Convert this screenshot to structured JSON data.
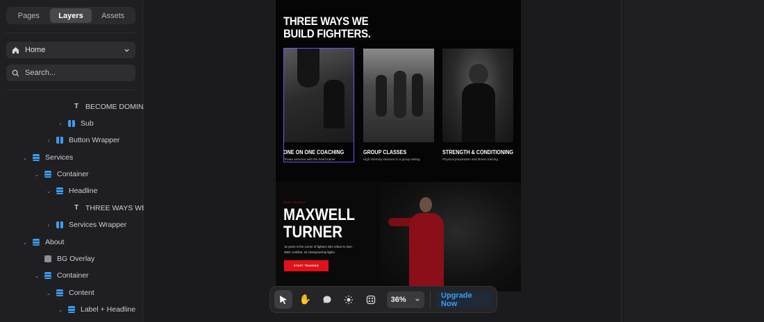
{
  "sidebar": {
    "tabs": [
      {
        "label": "Pages"
      },
      {
        "label": "Layers"
      },
      {
        "label": "Assets"
      }
    ],
    "page_select": {
      "value": "Home"
    },
    "search": {
      "placeholder": "Search..."
    },
    "layers": [
      {
        "label": "BECOME DOMINA",
        "icon": "text-icon",
        "depth": 4,
        "expandable": false
      },
      {
        "label": "Sub",
        "icon": "columns-icon",
        "depth": 3,
        "expandable": true
      },
      {
        "label": "Button Wrapper",
        "icon": "columns-icon",
        "depth": 2,
        "expandable": true
      },
      {
        "label": "Services",
        "icon": "stack-icon",
        "depth": 0,
        "expandable": true
      },
      {
        "label": "Container",
        "icon": "stack-icon",
        "depth": 1,
        "expandable": true
      },
      {
        "label": "Headline",
        "icon": "stack-icon",
        "depth": 2,
        "expandable": true
      },
      {
        "label": "THREE WAYS WE",
        "icon": "text-icon",
        "depth": 3,
        "expandable": false
      },
      {
        "label": "Services Wrapper",
        "icon": "columns-icon",
        "depth": 2,
        "expandable": true
      },
      {
        "label": "About",
        "icon": "stack-icon",
        "depth": 0,
        "expandable": true
      },
      {
        "label": "BG Overlay",
        "icon": "box-icon",
        "depth": 1,
        "expandable": false
      },
      {
        "label": "Container",
        "icon": "stack-icon",
        "depth": 1,
        "expandable": true
      },
      {
        "label": "Content",
        "icon": "stack-icon",
        "depth": 2,
        "expandable": true
      },
      {
        "label": "Label + Headline",
        "icon": "stack-icon",
        "depth": 3,
        "expandable": true
      }
    ]
  },
  "canvas": {
    "headline_line1": "THREE WAYS WE",
    "headline_line2": "BUILD FIGHTERS.",
    "cards": [
      {
        "title": "ONE ON ONE COACHING",
        "subtitle": "Private sessions with the head trainer"
      },
      {
        "title": "GROUP CLASSES",
        "subtitle": "High intensity sessions in a group setting"
      },
      {
        "title": "STRENGTH & CONDITIONING",
        "subtitle": "Physical preparation and fitness training"
      }
    ],
    "about": {
      "label": "HEAD TRAINER",
      "name_line1": "MAXWELL",
      "name_line2": "TURNER",
      "bio_line1": "15 years in the corner of fighters who refuse to lose.",
      "bio_line2": "WBC certified. 23 championship fights.",
      "cta": "START TRAINING"
    }
  },
  "toolbar": {
    "zoom": "36%",
    "upgrade_label": "Upgrade Now"
  },
  "colors": {
    "accent_blue": "#3b9cf6",
    "selection": "#7b4dff",
    "cta_red": "#e0111b"
  }
}
